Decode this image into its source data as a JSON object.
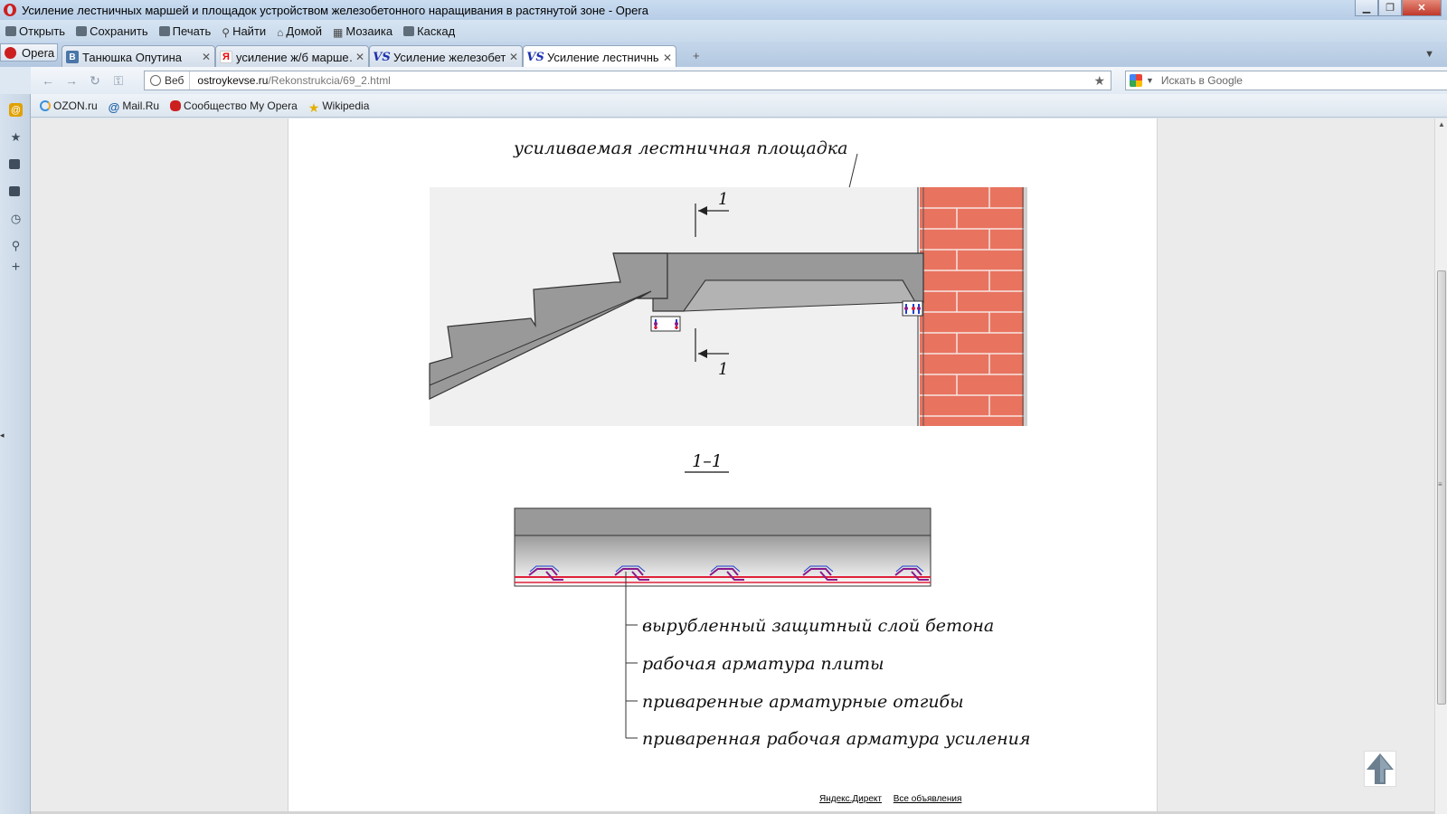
{
  "window": {
    "title": "Усиление лестничных маршей и площадок устройством железобетонного наращивания в растянутой зоне - Opera"
  },
  "menu": {
    "items": [
      {
        "label": "Открыть",
        "icon": "folder-icon"
      },
      {
        "label": "Сохранить",
        "icon": "save-icon"
      },
      {
        "label": "Печать",
        "icon": "print-icon"
      },
      {
        "label": "Найти",
        "icon": "find-icon"
      },
      {
        "label": "Домой",
        "icon": "home-icon"
      },
      {
        "label": "Мозаика",
        "icon": "tile-icon"
      },
      {
        "label": "Каскад",
        "icon": "cascade-icon"
      }
    ]
  },
  "tabs": {
    "opera_button": "Opera",
    "items": [
      {
        "label": "Танюшка Опутина",
        "favicon": "В"
      },
      {
        "label": "усиление ж/б марше…",
        "favicon": "Я"
      },
      {
        "label": "Усиление железобето…",
        "favicon": "VS"
      },
      {
        "label": "Усиление лестничных…",
        "favicon": "VS"
      }
    ],
    "new_tab": "+"
  },
  "address": {
    "web_badge": "Веб",
    "url_host": "ostroykevse.ru",
    "url_path": "/Rekonstrukcia/69_2.html",
    "search_placeholder": "Искать в Google"
  },
  "bookmarks": [
    {
      "label": "OZON.ru"
    },
    {
      "label": "Mail.Ru"
    },
    {
      "label": "Сообщество My Opera"
    },
    {
      "label": "Wikipedia"
    }
  ],
  "diagram": {
    "top_label": "усиливаемая лестничная площадка",
    "section_mark": "1",
    "section_title": "1–1",
    "legend": [
      "вырубленный защитный слой бетона",
      "рабочая арматура плиты",
      "приваренные арматурные отгибы",
      "приваренная рабочая арматура усиления"
    ],
    "colors": {
      "concrete": "#999999",
      "concrete_light": "#b3b3b3",
      "brick": "#e8735f",
      "rebar_red": "#e0203a",
      "rebar_purple": "#8a1a8a",
      "rebar_blue": "#1a3fd0"
    }
  },
  "ads": {
    "link1": "Яндекс.Директ",
    "link2": "Все объявления"
  }
}
